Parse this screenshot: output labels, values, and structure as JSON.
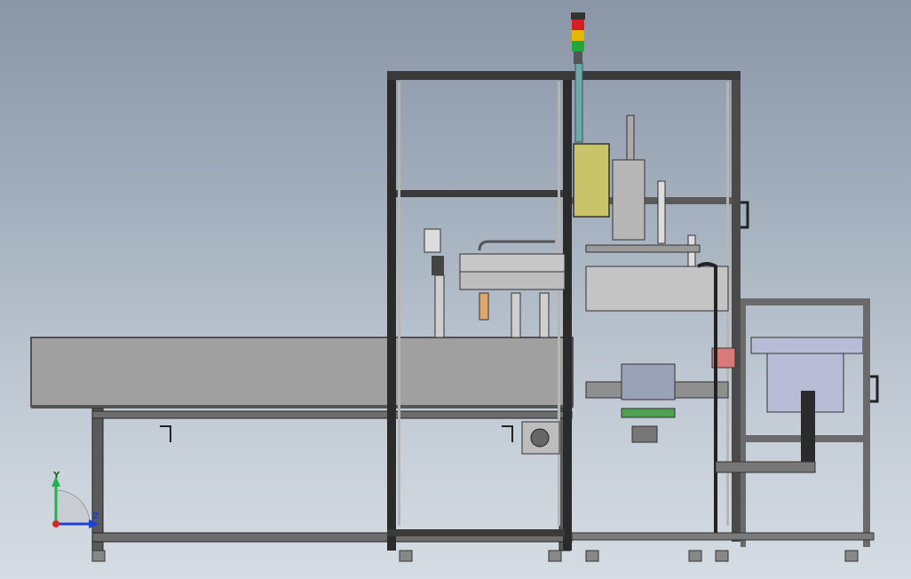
{
  "viewport": {
    "background_top": "#8a96a6",
    "background_bottom": "#d6dce3"
  },
  "triad": {
    "y_label": "Y",
    "z_label": "Z",
    "y_color": "#22b14c",
    "z_color": "#1f3fd6",
    "origin_color": "#d62828"
  },
  "stack_light": {
    "colors": [
      "#d42020",
      "#e6b800",
      "#22a83a"
    ]
  },
  "colors": {
    "frame": "#2b2b2b",
    "frame_light": "#9aa0a6",
    "table_top": "#9c9c9c",
    "control_box": "#c9c36a",
    "bowl_feeder": "#b8bcd6",
    "red_block": "#d97a7a"
  }
}
